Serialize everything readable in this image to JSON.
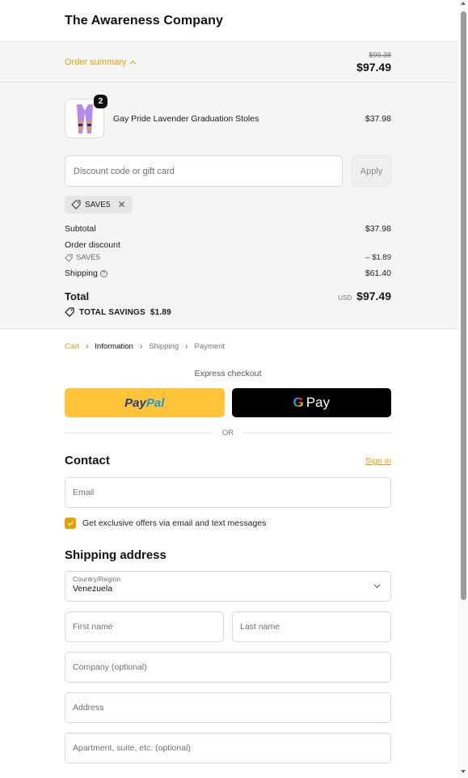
{
  "header": {
    "brand": "The Awareness Company"
  },
  "summary_bar": {
    "toggle_label": "Order summary",
    "old_price": "$99.38",
    "price": "$97.49"
  },
  "product": {
    "quantity": "2",
    "name": "Gay Pride Lavender Graduation Stoles",
    "price": "$37.98"
  },
  "discount": {
    "placeholder": "Discount code or gift card",
    "apply_label": "Apply",
    "applied_code": "SAVE5"
  },
  "lines": {
    "subtotal_label": "Subtotal",
    "subtotal_value": "$37.98",
    "discount_label": "Order discount",
    "discount_code": "SAVE5",
    "discount_value": "– $1.89",
    "shipping_label": "Shipping",
    "shipping_value": "$61.40"
  },
  "total": {
    "label": "Total",
    "currency": "USD",
    "value": "$97.49",
    "savings_label": "TOTAL SAVINGS",
    "savings_value": "$1.89"
  },
  "breadcrumb": [
    "Cart",
    "Information",
    "Shipping",
    "Payment"
  ],
  "express": {
    "label": "Express checkout",
    "paypal_a": "Pay",
    "paypal_b": "Pal",
    "gpay_g": "G",
    "gpay_text": "Pay",
    "or": "OR"
  },
  "contact": {
    "title": "Contact",
    "signin": "Sign in",
    "email_placeholder": "Email",
    "offers_label": "Get exclusive offers via email and text messages"
  },
  "shipping_address": {
    "title": "Shipping address",
    "country_label": "Country/Region",
    "country_value": "Venezuela",
    "first_name": "First name",
    "last_name": "Last name",
    "company": "Company (optional)",
    "address": "Address",
    "apartment": "Apartment, suite, etc. (optional)"
  },
  "colors": {
    "accent": "#e0a106",
    "paypal_yellow": "#ffc439",
    "panel_bg": "#f5f5f5"
  },
  "icons": [
    "chevron-up-icon",
    "tag-icon",
    "close-icon",
    "help-icon",
    "chevron-right-icon",
    "checkbox-check-icon",
    "chevron-down-icon"
  ]
}
